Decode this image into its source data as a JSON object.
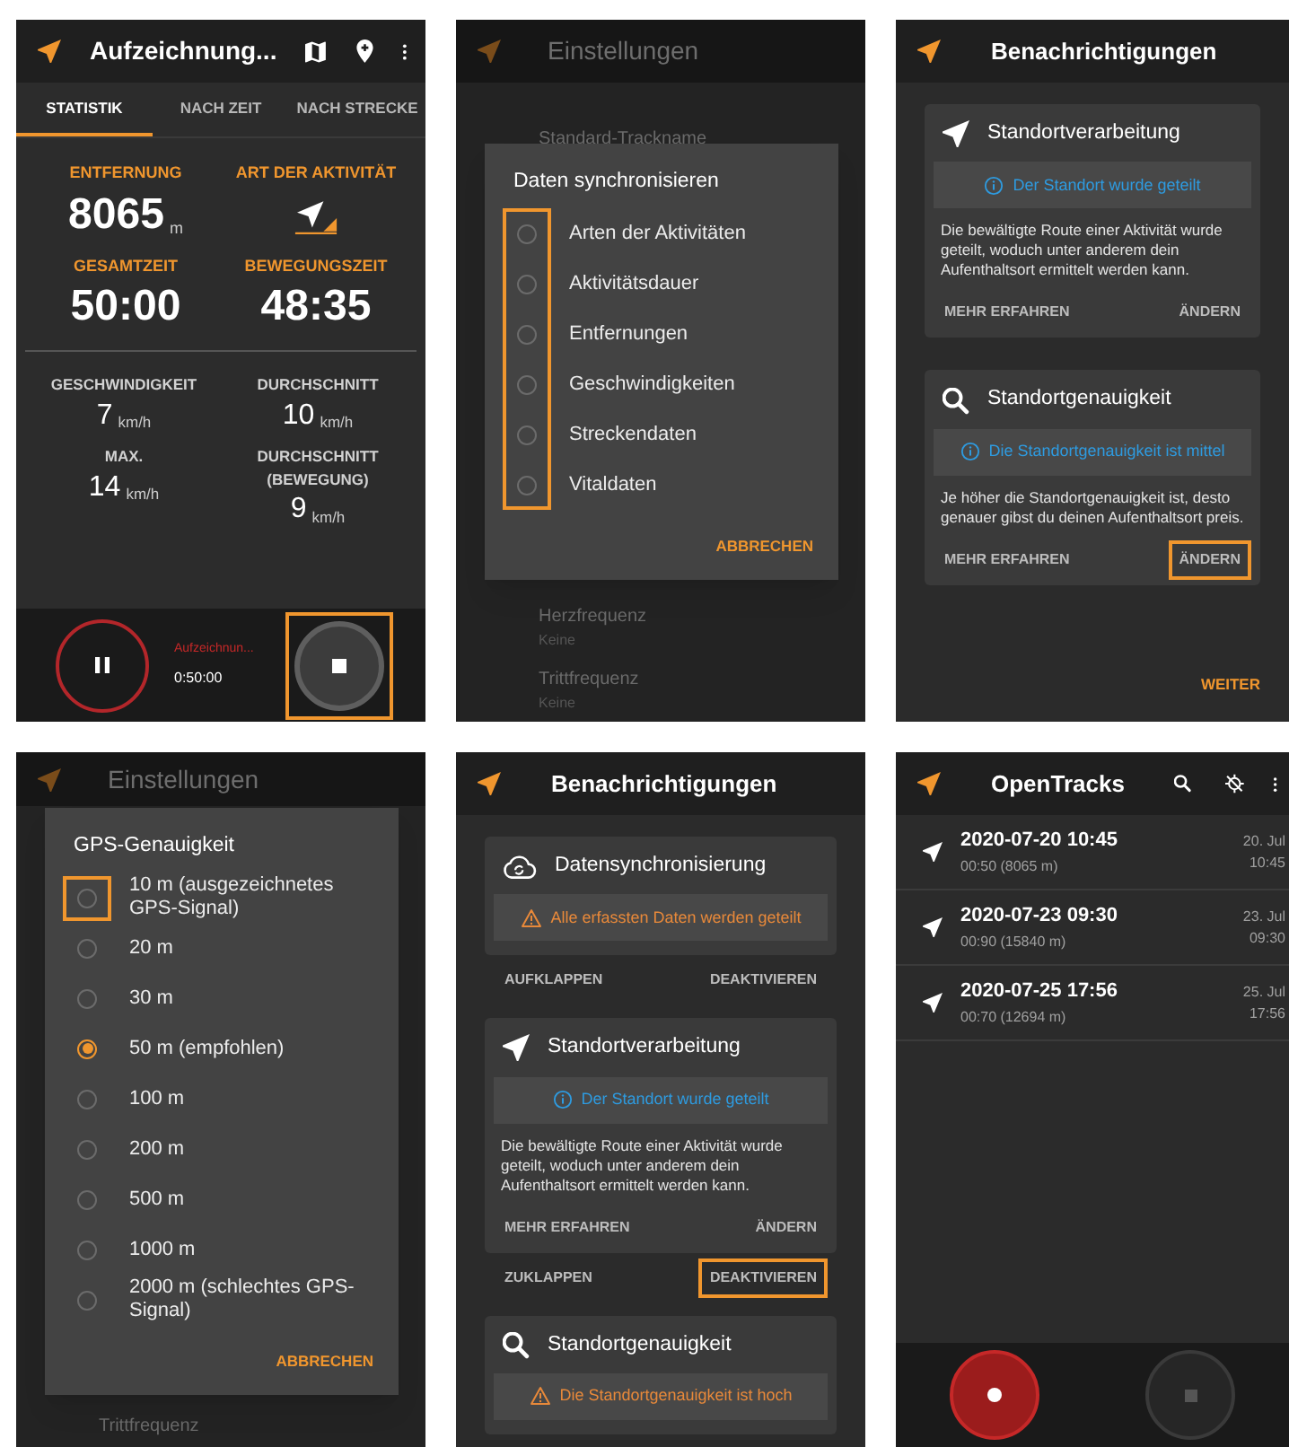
{
  "screens": [
    {
      "kind": "recording",
      "title": "Aufzeichnung...",
      "tabs": [
        {
          "label": "STATISTIK",
          "selected": true
        },
        {
          "label": "NACH ZEIT",
          "selected": false
        },
        {
          "label": "NACH STRECKE",
          "selected": false
        }
      ],
      "primary_stats": [
        {
          "kind": "value",
          "label": "ENTFERNUNG",
          "value": "8065",
          "unit": "m"
        },
        {
          "kind": "activity",
          "label": "ART DER AKTIVITÄT"
        },
        {
          "kind": "value",
          "label": "GESAMTZEIT",
          "value": "50:00"
        },
        {
          "kind": "value",
          "label": "BEWEGUNGSZEIT",
          "value": "48:35"
        }
      ],
      "secondary_stats": [
        {
          "label": "GESCHWINDIGKEIT",
          "value": "7",
          "unit": "km/h"
        },
        {
          "label": "DURCHSCHNITT",
          "value": "10",
          "unit": "km/h"
        },
        {
          "label": "MAX.",
          "value": "14",
          "unit": "km/h"
        },
        {
          "label": "DURCHSCHNITT (BEWEGUNG)",
          "value": "9",
          "unit": "km/h"
        }
      ],
      "recording_status": "Aufzeichnun...",
      "elapsed": "0:50:00",
      "stop_highlighted": true
    },
    {
      "kind": "settings_dialog",
      "title": "Einstellungen",
      "settings_above": [
        {
          "label": "Standard-Trackname"
        }
      ],
      "settings_below": [
        {
          "label": "Herzfrequenz",
          "value": "Keine"
        },
        {
          "label": "Trittfrequenz",
          "value": "Keine"
        }
      ],
      "dialog": {
        "title": "Daten synchronisieren",
        "controls_highlighted": true,
        "options": [
          {
            "label": "Arten der Aktivitäten",
            "checked": false
          },
          {
            "label": "Aktivitätsdauer",
            "checked": false
          },
          {
            "label": "Entfernungen",
            "checked": false
          },
          {
            "label": "Geschwindigkeiten",
            "checked": false
          },
          {
            "label": "Streckendaten",
            "checked": false
          },
          {
            "label": "Vitaldaten",
            "checked": false
          }
        ],
        "button": "ABBRECHEN"
      }
    },
    {
      "kind": "notifications",
      "title": "Benachrichtigungen",
      "cards": [
        {
          "kind": "navigation",
          "title": "Standortverarbeitung",
          "notice": {
            "kind": "info",
            "text": "Der Standort wurde geteilt"
          },
          "body": "Die bewältigte Route einer Aktivität wurde geteilt, woduch unter anderem dein Aufenthaltsort ermittelt werden kann.",
          "actions": [
            {
              "label": "MEHR ERFAHREN",
              "highlighted": false
            },
            {
              "label": "ÄNDERN",
              "highlighted": false
            }
          ]
        },
        {
          "kind": "search",
          "title": "Standortgenauigkeit",
          "notice": {
            "kind": "info",
            "text": "Die Standortgenauigkeit ist mittel"
          },
          "body": "Je höher die Standortgenauigkeit ist, desto genauer gibst du deinen Aufenthaltsort preis.",
          "actions": [
            {
              "label": "MEHR ERFAHREN",
              "highlighted": false
            },
            {
              "label": "ÄNDERN",
              "highlighted": true
            }
          ]
        }
      ],
      "footer_button": "WEITER"
    },
    {
      "kind": "settings_dialog",
      "title": "Einstellungen",
      "settings_below": [
        {
          "label": "Trittfrequenz"
        }
      ],
      "dialog": {
        "title": "GPS-Genauigkeit",
        "options": [
          {
            "label": "10 m (ausgezeichnetes GPS-Signal)",
            "selected": false,
            "highlighted": true
          },
          {
            "label": "20 m",
            "selected": false,
            "highlighted": false
          },
          {
            "label": "30 m",
            "selected": false,
            "highlighted": false
          },
          {
            "label": "50 m (empfohlen)",
            "selected": true,
            "highlighted": false
          },
          {
            "label": "100 m",
            "selected": false,
            "highlighted": false
          },
          {
            "label": "200 m",
            "selected": false,
            "highlighted": false
          },
          {
            "label": "500 m",
            "selected": false,
            "highlighted": false
          },
          {
            "label": "1000 m",
            "selected": false,
            "highlighted": false
          },
          {
            "label": "2000 m (schlechtes GPS-Signal)",
            "selected": false,
            "highlighted": false
          }
        ],
        "button": "ABBRECHEN"
      }
    },
    {
      "kind": "notifications",
      "title": "Benachrichtigungen",
      "cards": [
        {
          "kind": "cloud",
          "title": "Datensynchronisierung",
          "notice": {
            "kind": "warning",
            "text": "Alle erfassten Daten werden geteilt"
          },
          "outer_actions": [
            {
              "label": "AUFKLAPPEN",
              "highlighted": false
            },
            {
              "label": "DEAKTIVIEREN",
              "highlighted": false
            }
          ]
        },
        {
          "kind": "navigation",
          "title": "Standortverarbeitung",
          "notice": {
            "kind": "info",
            "text": "Der Standort wurde geteilt"
          },
          "body": "Die bewältigte Route einer Aktivität wurde geteilt, woduch unter anderem dein Aufenthaltsort ermittelt werden kann.",
          "actions": [
            {
              "label": "MEHR ERFAHREN",
              "highlighted": false
            },
            {
              "label": "ÄNDERN",
              "highlighted": false
            }
          ],
          "outer_actions": [
            {
              "label": "ZUKLAPPEN",
              "highlighted": false
            },
            {
              "label": "DEAKTIVIEREN",
              "highlighted": true
            }
          ]
        },
        {
          "kind": "search",
          "title": "Standortgenauigkeit",
          "notice": {
            "kind": "warning",
            "text": "Die Standortgenauigkeit ist hoch"
          }
        }
      ]
    },
    {
      "kind": "track_list",
      "title": "OpenTracks",
      "tracks": [
        {
          "name": "2020-07-20 10:45",
          "summary": "00:50 (8065 m)",
          "date": "20. Jul",
          "time": "10:45"
        },
        {
          "name": "2020-07-23 09:30",
          "summary": "00:90 (15840 m)",
          "date": "23. Jul",
          "time": "09:30"
        },
        {
          "name": "2020-07-25 17:56",
          "summary": "00:70 (12694 m)",
          "date": "25. Jul",
          "time": "17:56"
        }
      ]
    }
  ]
}
